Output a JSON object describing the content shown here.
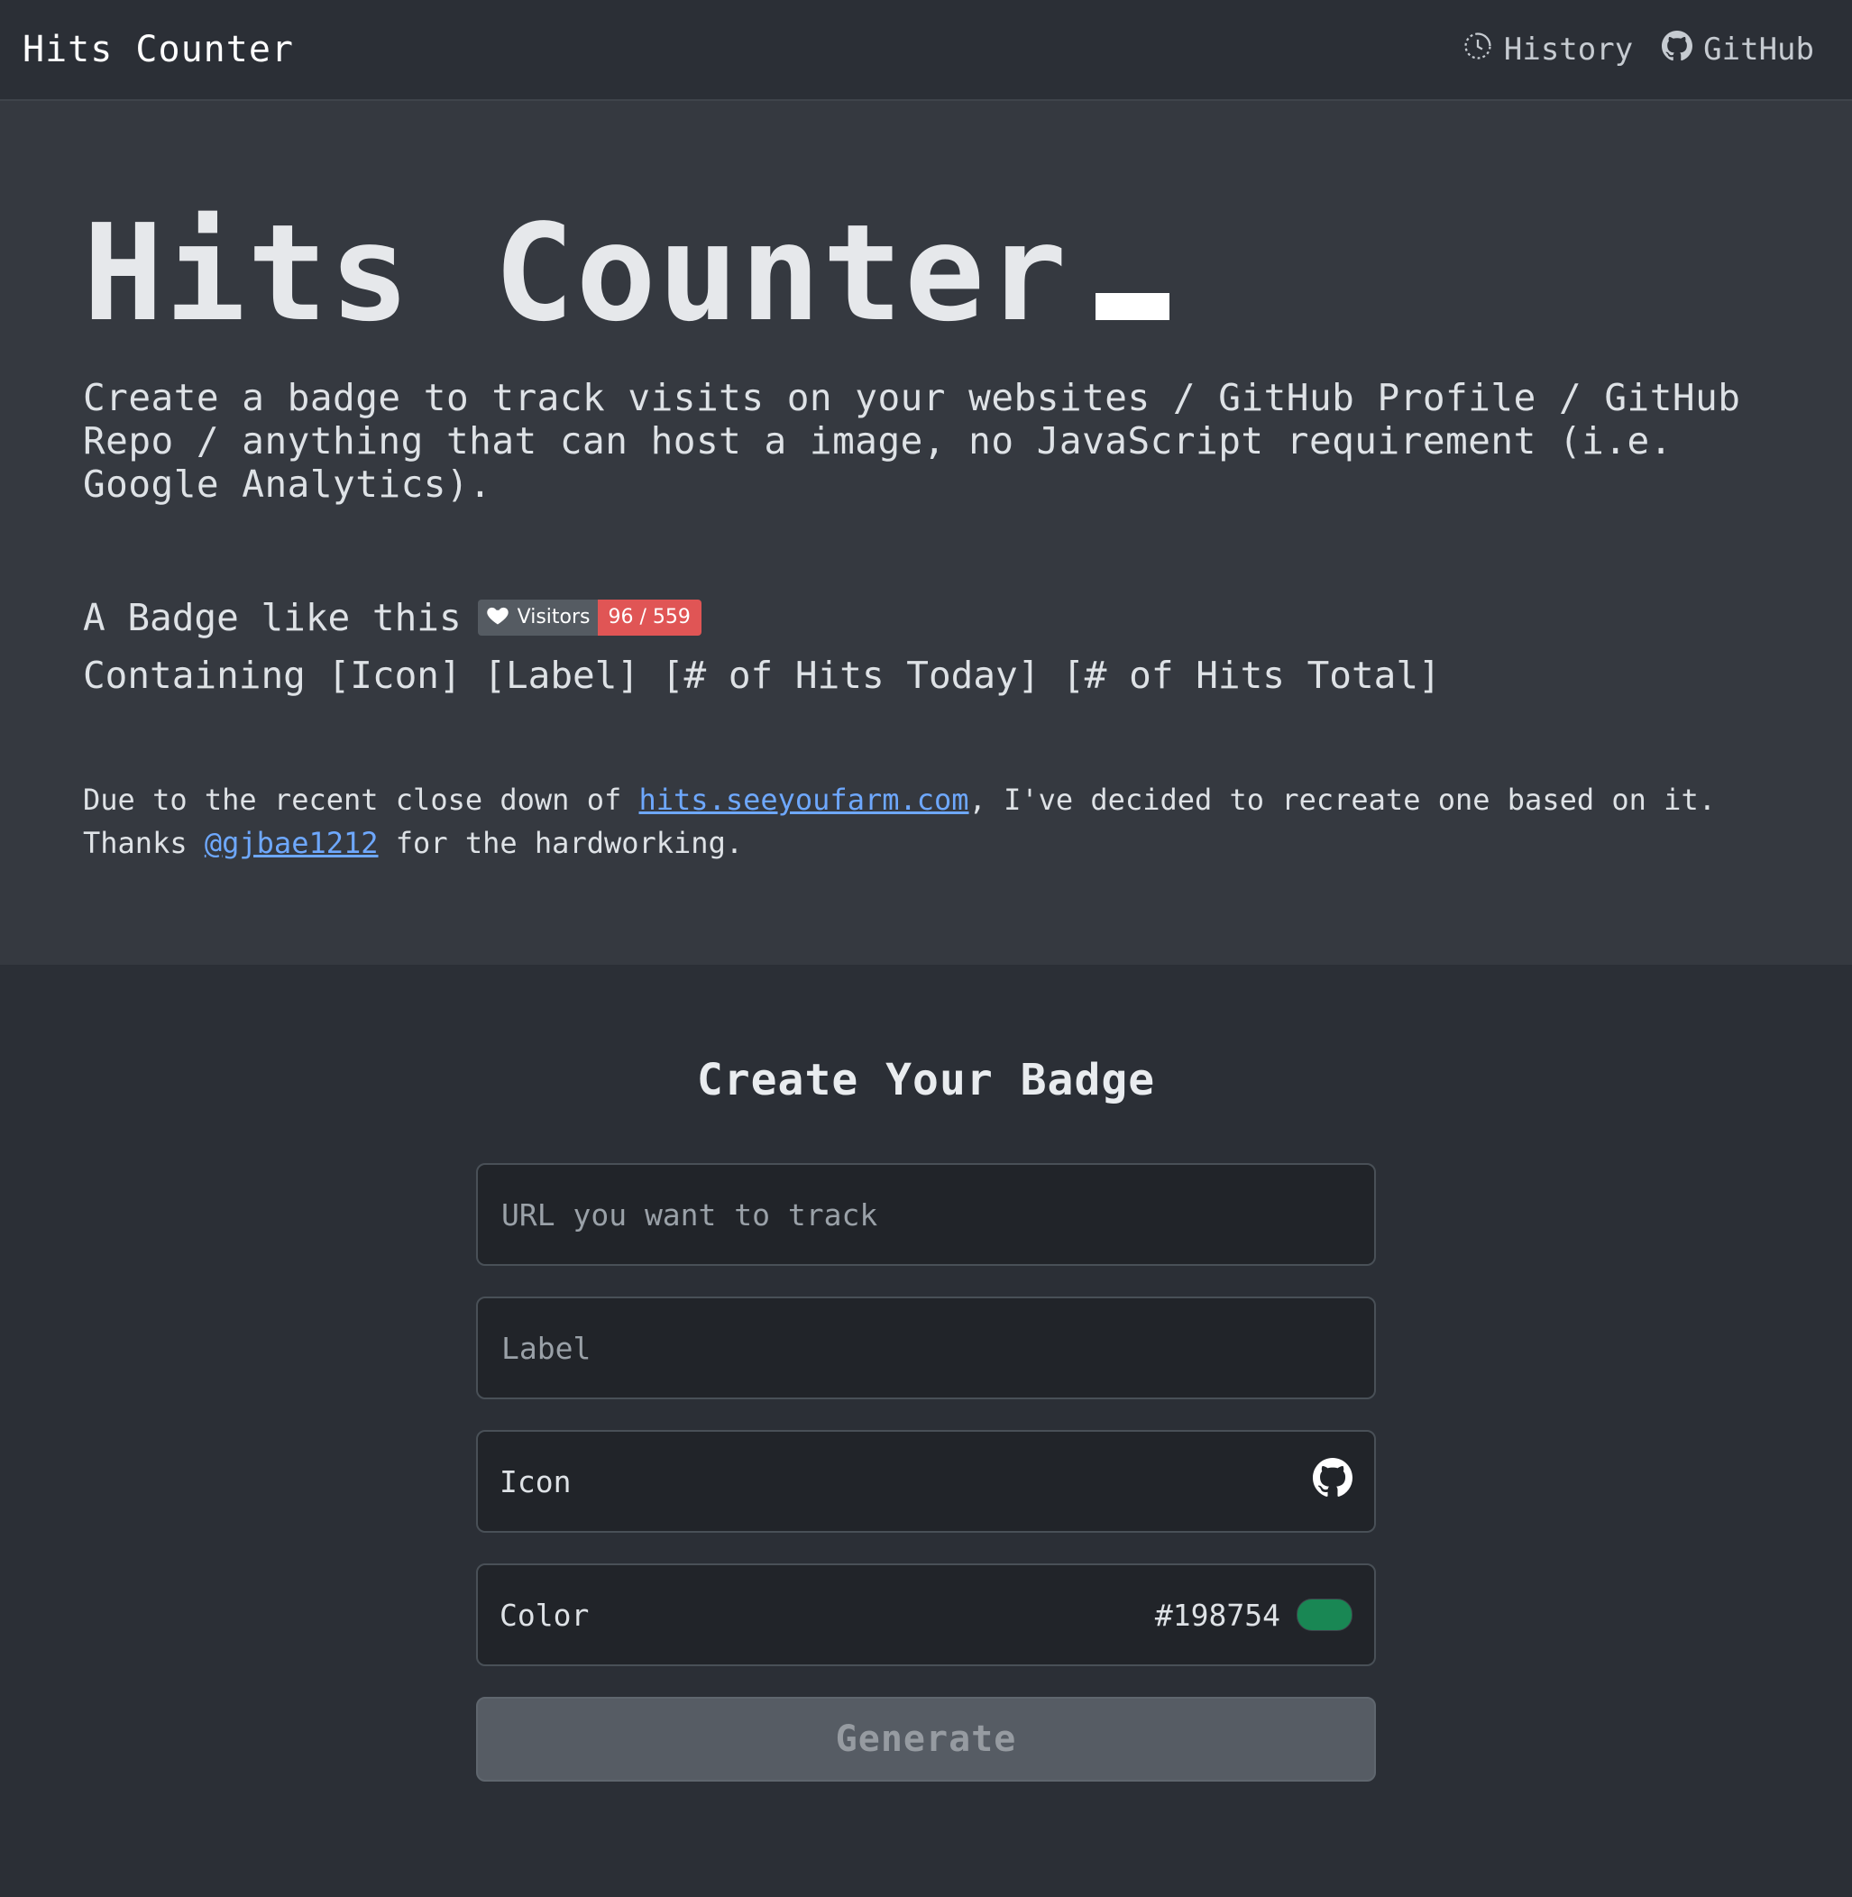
{
  "navbar": {
    "brand": "Hits Counter",
    "links": [
      {
        "label": "History",
        "icon": "history-icon"
      },
      {
        "label": "GitHub",
        "icon": "github-icon"
      }
    ]
  },
  "hero": {
    "title": "Hits Counter",
    "lead": "Create a badge to track visits on your websites / GitHub Profile / GitHub Repo / anything that can host a image, no JavaScript requirement (i.e. Google Analytics).",
    "badge_intro": "A Badge like this",
    "badge": {
      "icon": "heart-icon",
      "label": "Visitors",
      "value": "96 / 559",
      "value_color": "#e05555"
    },
    "containing": "Containing [Icon] [Label] [# of Hits Today] [# of Hits Total]",
    "note": {
      "prefix": "Due to the recent close down of ",
      "link1": "hits.seeyoufarm.com",
      "middle": ", I've decided to recreate one based on it.",
      "thanks_prefix": "Thanks ",
      "link2": "@gjbae1212",
      "suffix": " for the hardworking."
    }
  },
  "create": {
    "title": "Create Your Badge",
    "url_placeholder": "URL you want to track",
    "label_placeholder": "Label",
    "icon_label": "Icon",
    "icon_selected": "github-icon",
    "color_label": "Color",
    "color_value": "#198754",
    "generate_label": "Generate"
  }
}
